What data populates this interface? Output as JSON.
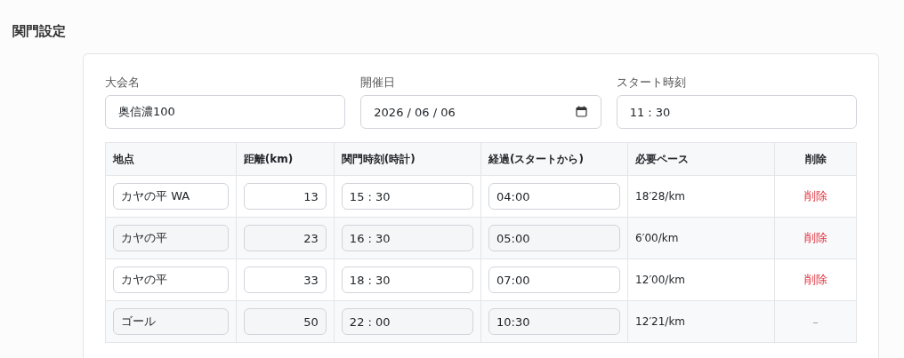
{
  "title": "関門設定",
  "fields": [
    {
      "label": "大会名",
      "value": "奥信濃100",
      "kind": "text"
    },
    {
      "label": "開催日",
      "value": "2026 / 06 / 06",
      "kind": "date"
    },
    {
      "label": "スタート時刻",
      "value": "11 : 30",
      "kind": "time"
    }
  ],
  "table": {
    "columns": [
      "地点",
      "距離(km)",
      "関門時刻(時計)",
      "経過(スタートから)",
      "必要ペース",
      "削除"
    ],
    "rows": [
      {
        "point": "カヤの平 WA",
        "distance": "13",
        "cutoff": "15 : 30",
        "elapsed": "04:00",
        "pace": "18′28/km",
        "action": "削除",
        "kind": "delete"
      },
      {
        "point": "カヤの平",
        "distance": "23",
        "cutoff": "16 : 30",
        "elapsed": "05:00",
        "pace": "6′00/km",
        "action": "削除",
        "kind": "delete"
      },
      {
        "point": "カヤの平",
        "distance": "33",
        "cutoff": "18 : 30",
        "elapsed": "07:00",
        "pace": "12′00/km",
        "action": "削除",
        "kind": "delete"
      },
      {
        "point": "ゴール",
        "distance": "50",
        "cutoff": "22 : 00",
        "elapsed": "10:30",
        "pace": "12′21/km",
        "action": "–",
        "kind": "none"
      }
    ]
  }
}
